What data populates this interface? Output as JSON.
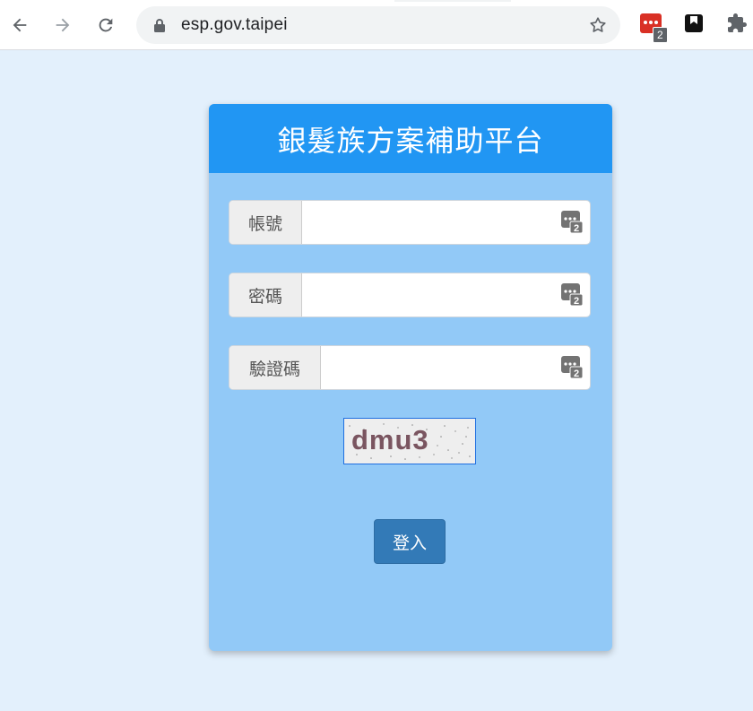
{
  "browser": {
    "url": "esp.gov.taipei",
    "extension_badge": "2",
    "icons": [
      "back-arrow-icon",
      "forward-arrow-icon",
      "reload-icon",
      "lock-icon",
      "star-icon",
      "password-manager-extension-icon",
      "bookmark-extension-icon",
      "puzzle-extensions-icon"
    ]
  },
  "login": {
    "title": "銀髮族方案補助平台",
    "account_label": "帳號",
    "account_value": "",
    "password_label": "密碼",
    "password_value": "",
    "captcha_label": "驗證碼",
    "captcha_value": "",
    "captcha_text": "dmu3",
    "login_button": "登入",
    "field_icon_badge": "2"
  },
  "colors": {
    "page_bg": "#e3f0fc",
    "card_bg": "#92c9f7",
    "header_bg": "#2196f3",
    "button_bg": "#337ab7",
    "extension_red": "#d93025"
  }
}
